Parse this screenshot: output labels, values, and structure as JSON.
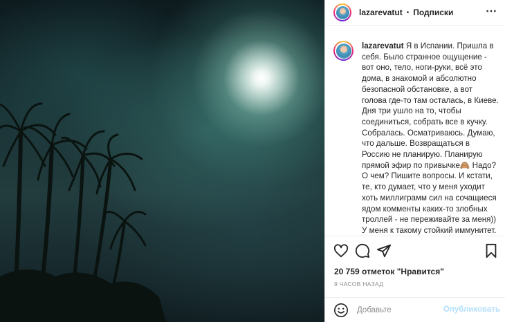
{
  "post": {
    "username": "lazarevatut",
    "dot": "•",
    "follow_label": "Подписки",
    "more_icon": "⋯",
    "caption_user": "lazarevatut",
    "caption_text": "Я в Испании. Пришла в себя. Было странное ощущение - вот оно, тело, ноги-руки, всё это дома, в знакомой и абсолютно безопасной обстановке, а вот голова где-то там осталась, в Киеве. Дня три ушло на то, чтобы соединиться, собрать все в кучку. Собралась. Осматриваюсь. Думаю, что дальше. Возвращаться в Россию не планирую. Планирую прямой эфир по привычке🙈 Надо? О чем? Пишите вопросы. И кстати, те, кто думает, что у меня уходит хоть миллиграмм сил на сочащиеся ядом комменты каких-то злобных троллей - не переживайте за меня)) У меня к такому стойкий иммунитет. И вы не обращайте внимания, не кормите троллей - подкармливайте себя любовью и хорошими новостями.",
    "likes": "20 759 отметок \"Нравится\"",
    "time_ago": "9 ЧАСОВ НАЗАД",
    "comment_placeholder": "Добавьте",
    "publish_label": "Опубликовать"
  },
  "colors": {
    "link_disabled": "#b2dffc",
    "text": "#262626",
    "muted": "#8e8e8e"
  }
}
